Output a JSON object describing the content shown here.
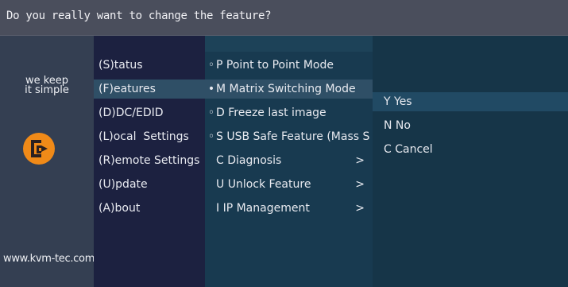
{
  "dialog": {
    "title": "Do you really want to change the feature?"
  },
  "brand": {
    "slogan_line1": "we keep",
    "slogan_line2": "it simple",
    "website": "www.kvm-tec.com",
    "logo_color": "#f08a18"
  },
  "main_menu": [
    {
      "label": "(S)tatus"
    },
    {
      "label": "(F)eatures",
      "selected": true
    },
    {
      "label": "(D)DC/EDID"
    },
    {
      "label": "(L)ocal  Settings"
    },
    {
      "label": "(R)emote Settings"
    },
    {
      "label": "(U)pdate"
    },
    {
      "label": "(A)bout"
    }
  ],
  "features_menu": [
    {
      "bullet": "◦",
      "label": "P Point to Point Mode"
    },
    {
      "bullet": "•",
      "label": "M Matrix Switching Mode"
    },
    {
      "bullet": "◦",
      "label": "D Freeze last image"
    },
    {
      "bullet": "◦",
      "label": "S USB Safe Feature (Mass S"
    },
    {
      "label": "C Diagnosis",
      "arrow": ">"
    },
    {
      "label": "U Unlock Feature",
      "arrow": ">"
    },
    {
      "label": "I IP Management",
      "arrow": ">"
    }
  ],
  "confirm_menu": [
    {
      "label": "Y Yes",
      "selected": true
    },
    {
      "label": "N No"
    },
    {
      "label": "C Cancel"
    }
  ],
  "colors": {
    "title_bar": "#4a4e5c",
    "brand_panel": "#343f52",
    "menu1_bg": "#1c2140",
    "menu2_bg": "#183a50",
    "menu3_bg": "#163548",
    "highlight": "#2f4f66"
  }
}
